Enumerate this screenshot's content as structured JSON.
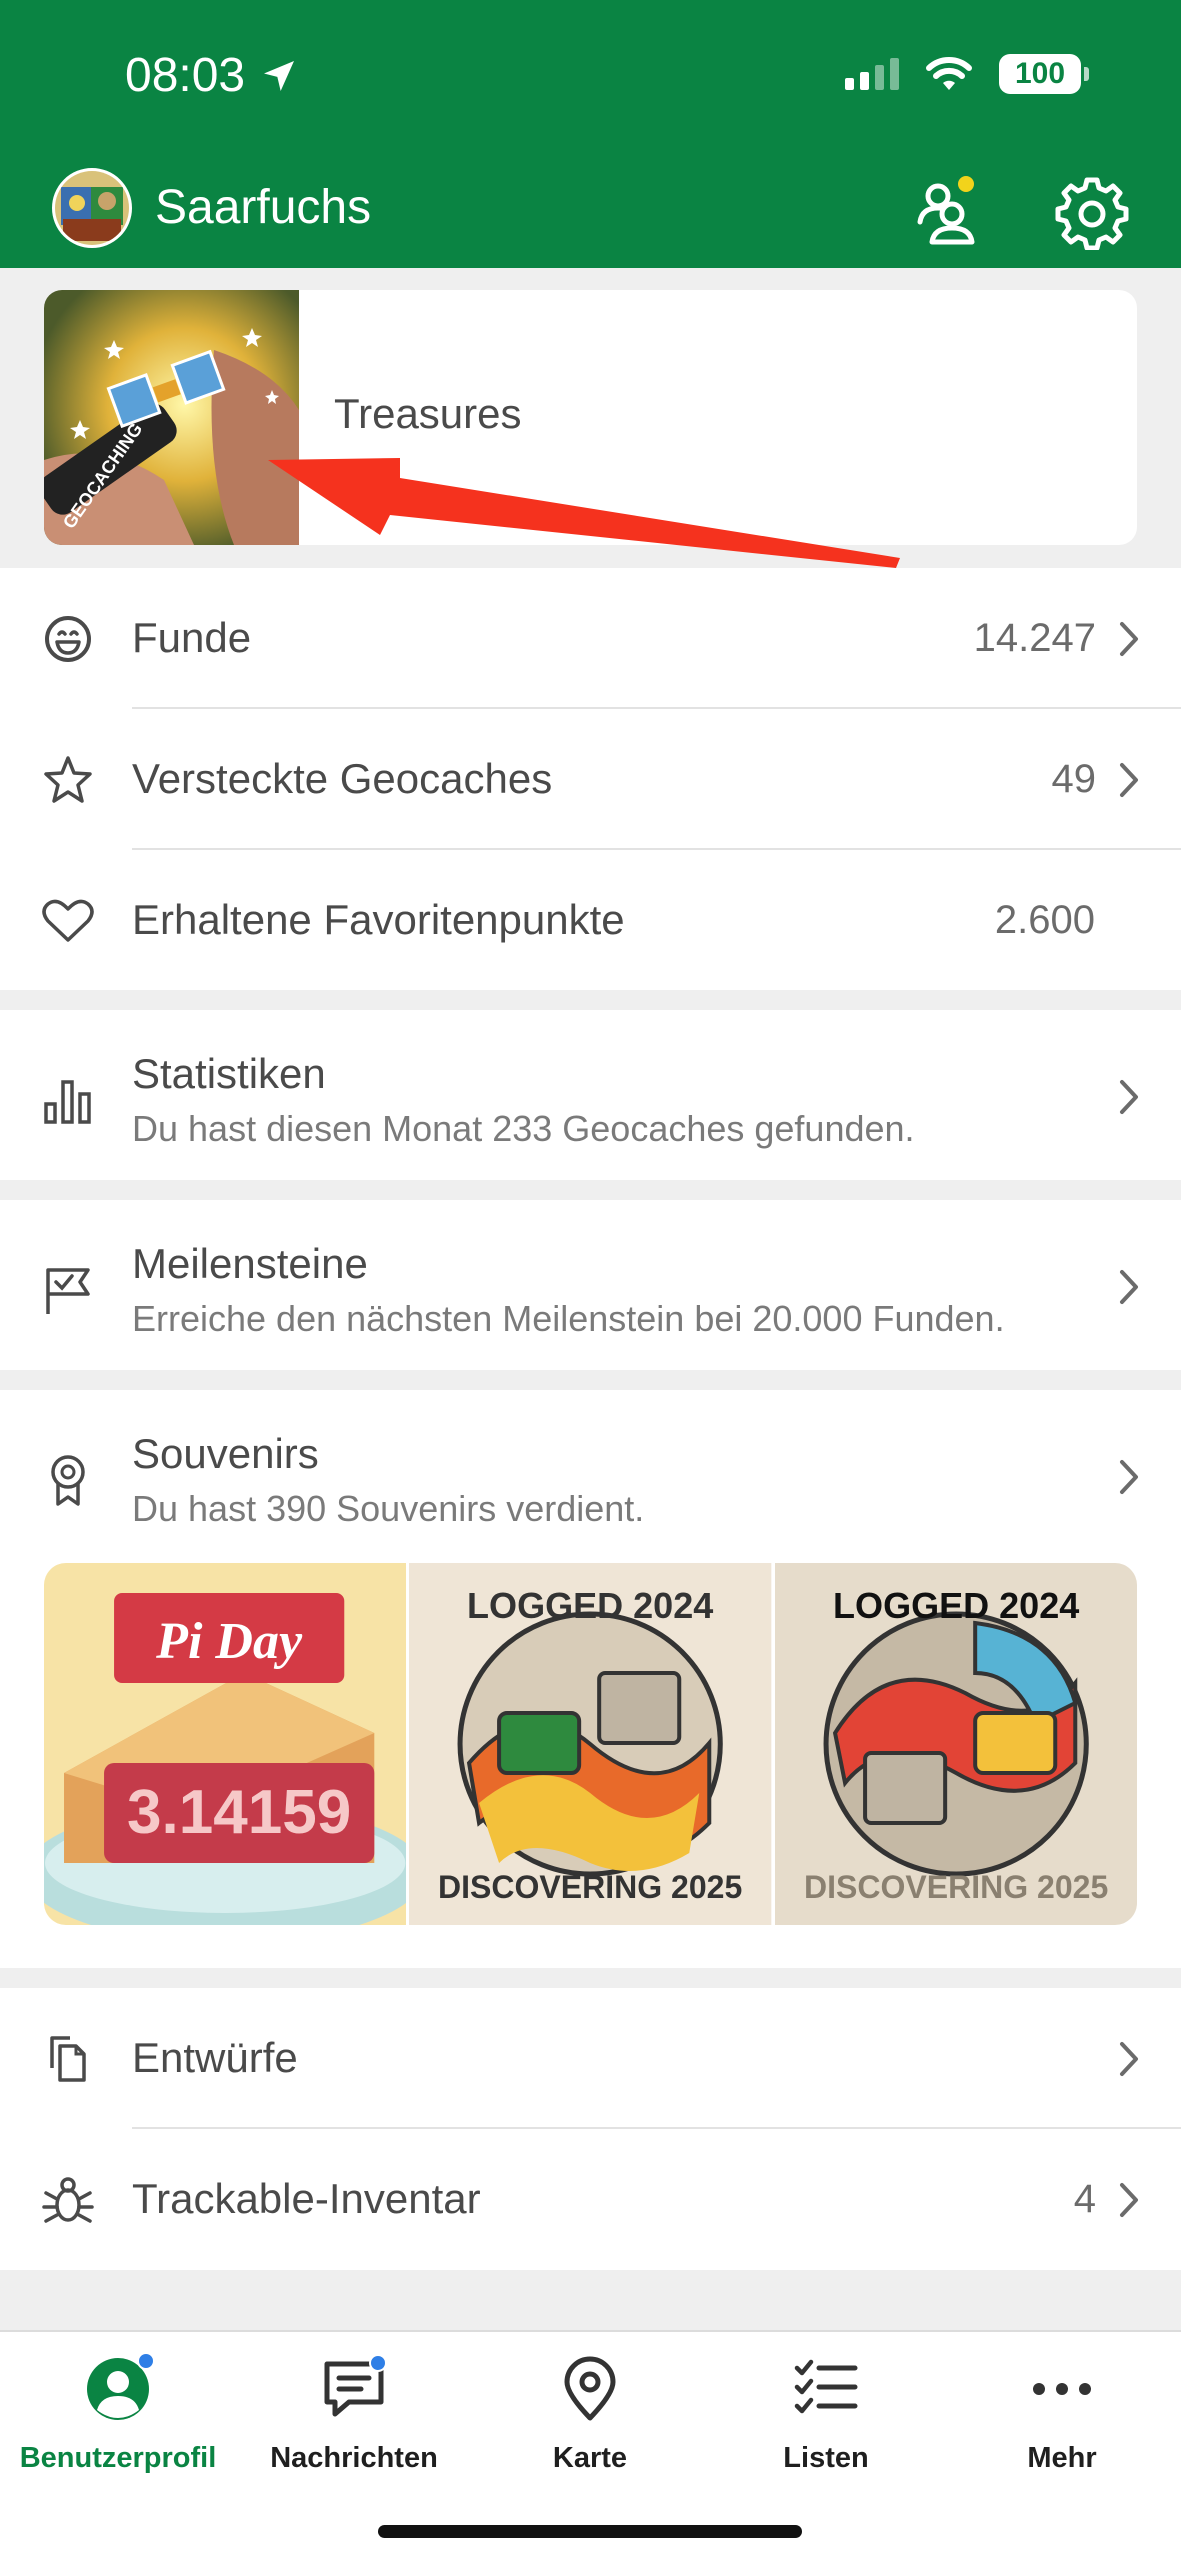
{
  "status_bar": {
    "time": "08:03",
    "battery": "100"
  },
  "header": {
    "title": "Saarfuchs",
    "avatar_text": "Saarfuchs"
  },
  "treasures": {
    "label": "Treasures",
    "image_text": "GEOCACHING"
  },
  "stats": [
    {
      "label": "Funde",
      "value": "14.247",
      "icon": "smile-icon"
    },
    {
      "label": "Versteckte Geocaches",
      "value": "49",
      "icon": "star-icon"
    },
    {
      "label": "Erhaltene Favoritenpunkte",
      "value": "2.600",
      "icon": "heart-icon"
    }
  ],
  "statistiken": {
    "title": "Statistiken",
    "subtitle": "Du hast diesen Monat 233 Geocaches gefunden."
  },
  "meilensteine": {
    "title": "Meilensteine",
    "subtitle": "Erreiche den nächsten Meilenstein bei 20.000 Funden."
  },
  "souvenirs": {
    "title": "Souvenirs",
    "subtitle": "Du hast 390 Souvenirs verdient.",
    "items": [
      {
        "top": "Pi Day",
        "bottom": "3.14159"
      },
      {
        "top": "LOGGED 2024",
        "bottom": "DISCOVERING 2025"
      },
      {
        "top": "LOGGED 2024",
        "bottom": "DISCOVERING 2025"
      }
    ]
  },
  "extras": [
    {
      "label": "Entwürfe",
      "value": "",
      "icon": "drafts-icon"
    },
    {
      "label": "Trackable-Inventar",
      "value": "4",
      "icon": "bug-icon"
    }
  ],
  "tabs": [
    {
      "label": "Benutzerprofil",
      "icon": "profile-icon",
      "active": true
    },
    {
      "label": "Nachrichten",
      "icon": "messages-icon"
    },
    {
      "label": "Karte",
      "icon": "map-pin-icon"
    },
    {
      "label": "Listen",
      "icon": "list-icon"
    },
    {
      "label": "Mehr",
      "icon": "more-icon"
    }
  ],
  "colors": {
    "brand_green": "#0a8443",
    "badge_blue": "#2f7fe6",
    "arrow_red": "#f5321e"
  }
}
